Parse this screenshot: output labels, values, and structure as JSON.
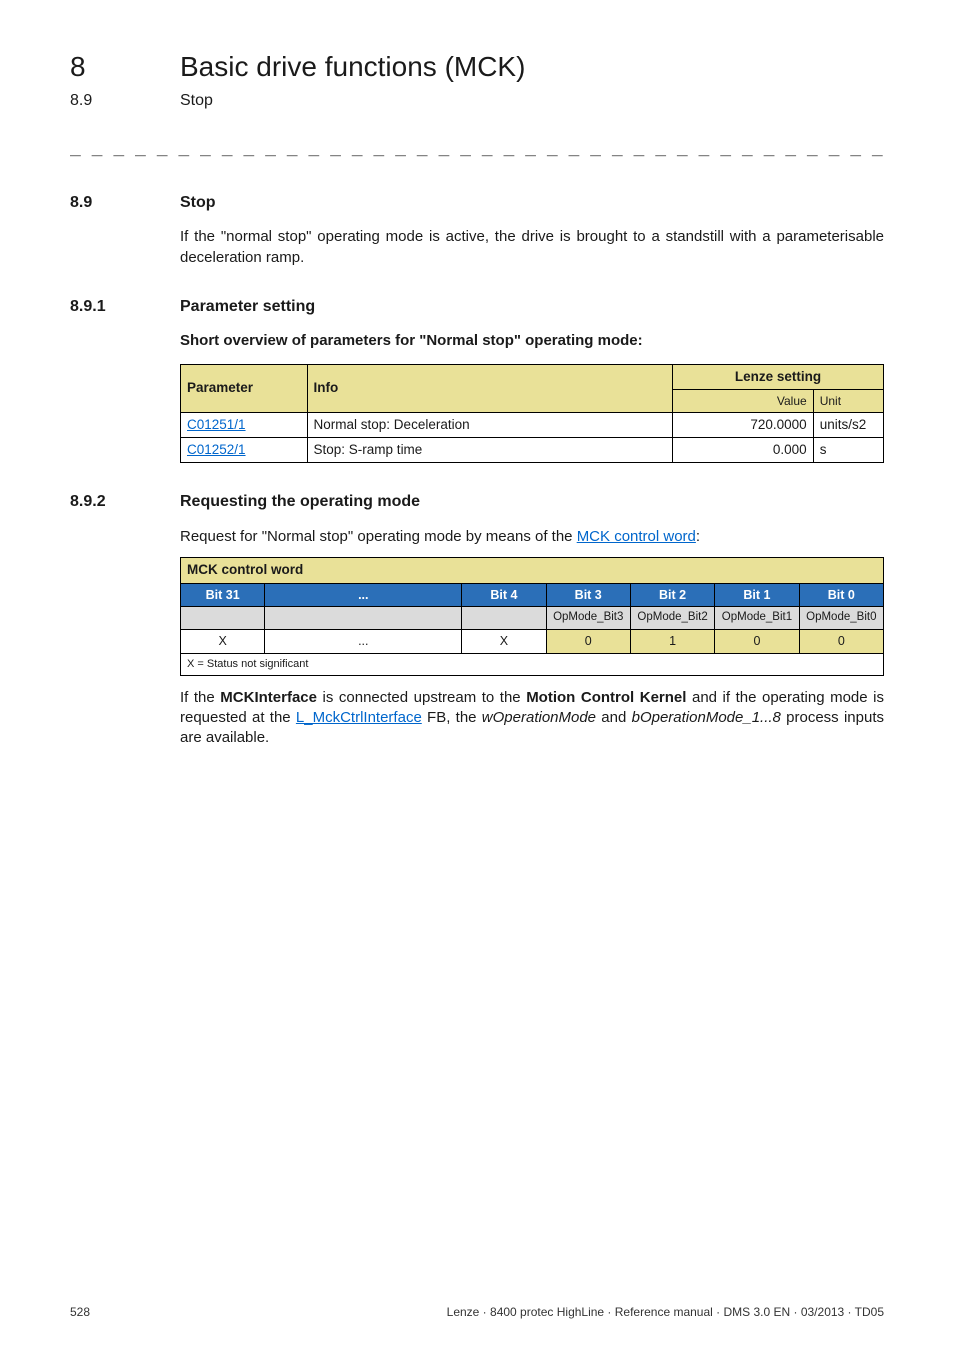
{
  "header": {
    "chapter_number": "8",
    "chapter_title": "Basic drive functions (MCK)",
    "section_number": "8.9",
    "section_title": "Stop"
  },
  "divider": "_ _ _ _ _ _ _ _ _ _ _ _ _ _ _ _ _ _ _ _ _ _ _ _ _ _ _ _ _ _ _ _ _ _ _ _ _ _ _ _ _ _ _ _ _ _ _ _ _ _ _ _ _ _ _ _ _ _ _ _ _ _ _ _",
  "sec_8_9": {
    "num": "8.9",
    "title": "Stop",
    "para": "If the \"normal stop\" operating mode is active, the drive is brought to a standstill with a parameterisable deceleration ramp."
  },
  "sec_8_9_1": {
    "num": "8.9.1",
    "title": "Parameter setting",
    "bold_line": "Short overview of parameters for \"Normal stop\" operating mode:",
    "table": {
      "headers": {
        "param": "Parameter",
        "info": "Info",
        "lenze": "Lenze setting"
      },
      "subheaders": {
        "value": "Value",
        "unit": "Unit"
      },
      "rows": [
        {
          "param": "C01251/1",
          "info": "Normal stop: Deceleration",
          "value": "720.0000",
          "unit": "units/s2"
        },
        {
          "param": "C01252/1",
          "info": "Stop: S-ramp time",
          "value": "0.000",
          "unit": "s"
        }
      ]
    }
  },
  "sec_8_9_2": {
    "num": "8.9.2",
    "title": "Requesting the operating mode",
    "intro_pre": "Request for \"Normal stop\" operating mode by means of the ",
    "intro_link": "MCK control word",
    "intro_post": ":",
    "mck": {
      "title": "MCK control word",
      "bits": [
        "Bit 31",
        "...",
        "Bit 4",
        "Bit 3",
        "Bit 2",
        "Bit 1",
        "Bit 0"
      ],
      "modes": [
        "",
        "",
        "",
        "OpMode_Bit3",
        "OpMode_Bit2",
        "OpMode_Bit1",
        "OpMode_Bit0"
      ],
      "values": [
        "X",
        "...",
        "X",
        "0",
        "1",
        "0",
        "0"
      ],
      "footnote": "X = Status not significant"
    },
    "after_para": {
      "t1": "If the ",
      "b1": "MCKInterface",
      "t2": " is connected upstream to the ",
      "b2": "Motion Control Kernel",
      "t3": " and if the operating mode is requested at the ",
      "link": "L_MckCtrlInterface",
      "t4": " FB, the ",
      "i1": "wOperationMode",
      "t5": " and ",
      "i2": "bOperationMode_1...8",
      "t6": " process inputs are available."
    }
  },
  "footer": {
    "page": "528",
    "right": "Lenze · 8400 protec HighLine · Reference manual · DMS 3.0 EN · 03/2013 · TD05"
  }
}
